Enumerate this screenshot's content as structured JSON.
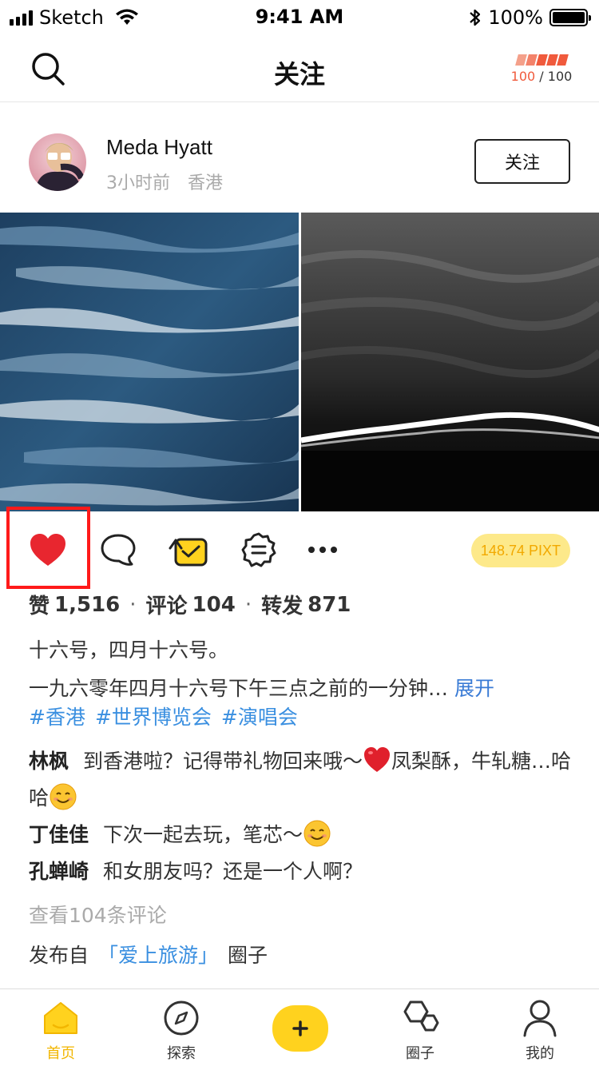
{
  "status_bar": {
    "carrier": "Sketch",
    "time": "9:41 AM",
    "battery": "100%"
  },
  "nav": {
    "title": "关注",
    "energy_current": "100",
    "energy_sep": " / ",
    "energy_max": "100"
  },
  "post": {
    "username": "Meda Hyatt",
    "time_ago": "3小时前",
    "location": "香港",
    "follow_label": "关注",
    "reward": "148.74 PIXT",
    "stats": {
      "likes_label": "赞",
      "likes": "1,516",
      "comments_label": "评论",
      "comments": "104",
      "shares_label": "转发",
      "shares": "871",
      "separator": "·"
    },
    "caption_line1": "十六号，四月十六号。",
    "caption_line2": "一九六零年四月十六号下午三点之前的一分钟…",
    "expand_label": "展开",
    "tags": [
      "#香港",
      "#世界博览会",
      "#演唱会"
    ],
    "comments_list": [
      {
        "author": "林枫",
        "text_before": "到香港啦？记得带礼物回来哦～",
        "text_middle": "凤梨酥，牛轧糖…哈哈",
        "text_after": ""
      },
      {
        "author": "丁佳佳",
        "text_before": "下次一起去玩，笔芯～",
        "text_middle": "",
        "text_after": ""
      },
      {
        "author": "孔蝉崎",
        "text_before": "和女朋友吗？还是一个人啊？",
        "text_middle": "",
        "text_after": ""
      }
    ],
    "view_all_comments": "查看104条评论",
    "publish_prefix": "发布自",
    "circle_name": "「爱上旅游」",
    "publish_suffix": "圈子"
  },
  "tab_bar": {
    "items": [
      {
        "label": "首页",
        "icon": "home-icon",
        "active": true
      },
      {
        "label": "探索",
        "icon": "compass-icon",
        "active": false
      },
      {
        "label": "",
        "icon": "plus-icon",
        "active": false
      },
      {
        "label": "圈子",
        "icon": "hexagon-icon",
        "active": false
      },
      {
        "label": "我的",
        "icon": "user-icon",
        "active": false
      }
    ]
  },
  "colors": {
    "accent_yellow": "#ffd21e",
    "link_blue": "#3a8fe0",
    "like_red": "#e8262f",
    "highlight_red": "#ff1a1a"
  }
}
